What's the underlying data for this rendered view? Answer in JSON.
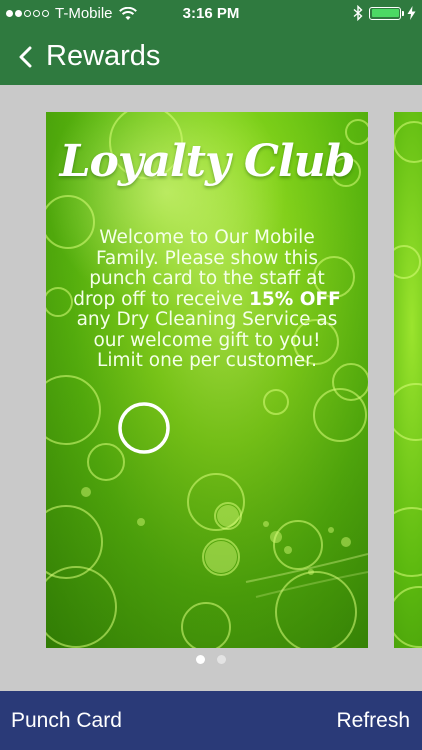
{
  "status_bar": {
    "carrier": "T-Mobile",
    "time": "3:16 PM",
    "signal_bars_filled": 2,
    "signal_bars_total": 5,
    "battery_level": 1.0
  },
  "nav": {
    "back_icon": "chevron-left-icon",
    "title": "Rewards"
  },
  "card": {
    "title": "Loyalty Club",
    "text_before": "Welcome to Our Mobile Family. Please show this punch card to the staff at drop off to receive ",
    "highlight": "15% OFF",
    "text_after": " any Dry Cleaning Service as our welcome gift to you! Limit one per customer."
  },
  "pager": {
    "pages": 2,
    "active": 0
  },
  "bottom_bar": {
    "left_label": "Punch Card",
    "right_label": "Refresh"
  },
  "colors": {
    "header": "#2f7a3f",
    "bottom_bar": "#2a3a78",
    "background": "#c9c9c9",
    "battery_fill": "#4cd964"
  }
}
